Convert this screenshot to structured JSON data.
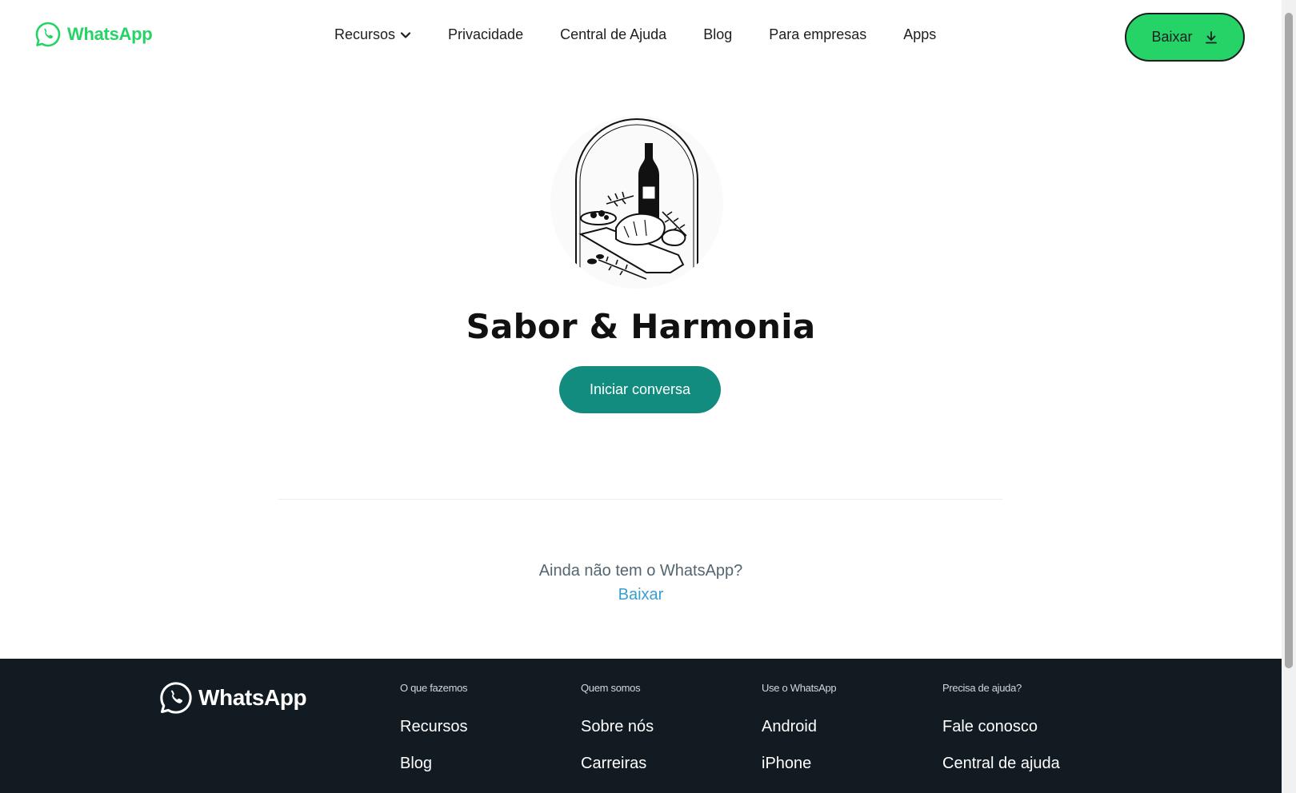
{
  "header": {
    "logo_text": "WhatsApp",
    "nav": [
      {
        "label": "Recursos",
        "has_dropdown": true
      },
      {
        "label": "Privacidade"
      },
      {
        "label": "Central de Ajuda"
      },
      {
        "label": "Blog"
      },
      {
        "label": "Para empresas"
      },
      {
        "label": "Apps"
      }
    ],
    "download_label": "Baixar",
    "download_icon": "download-icon"
  },
  "main": {
    "business_name": "Sabor & Harmonia",
    "profile_image": "restaurant-logo-wine-bottle-and-food-illustration",
    "chat_button_label": "Iniciar conversa",
    "no_app_text": "Ainda não tem o WhatsApp?",
    "no_app_link": "Baixar"
  },
  "footer": {
    "logo_text": "WhatsApp",
    "columns": [
      {
        "title": "O que fazemos",
        "links": [
          "Recursos",
          "Blog"
        ]
      },
      {
        "title": "Quem somos",
        "links": [
          "Sobre nós",
          "Carreiras"
        ]
      },
      {
        "title": "Use o WhatsApp",
        "links": [
          "Android",
          "iPhone"
        ]
      },
      {
        "title": "Precisa de ajuda?",
        "links": [
          "Fale conosco",
          "Central de ajuda"
        ]
      }
    ]
  },
  "colors": {
    "brand_green": "#25d366",
    "teal_button": "#128c7e",
    "footer_bg": "#111b21",
    "link_blue": "#3a9fcf"
  }
}
